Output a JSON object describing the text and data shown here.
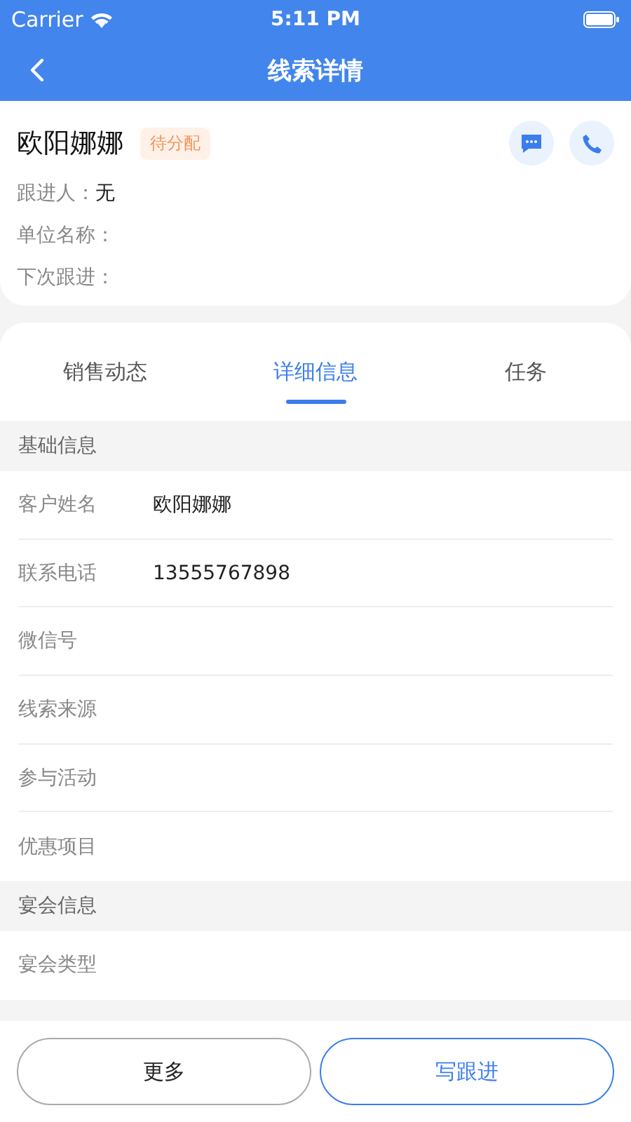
{
  "status_bar": {
    "carrier": "Carrier",
    "time": "5:11 PM"
  },
  "nav": {
    "title": "线索详情"
  },
  "lead": {
    "name": "欧阳娜娜",
    "badge": "待分配",
    "fields": [
      {
        "label": "跟进人：",
        "value": "无"
      },
      {
        "label": "单位名称："
      },
      {
        "label": "下次跟进："
      }
    ]
  },
  "tabs": [
    {
      "label": "销售动态",
      "selected": false
    },
    {
      "label": "详细信息",
      "selected": true
    },
    {
      "label": "任务",
      "selected": false
    }
  ],
  "sections": [
    {
      "title": "基础信息",
      "rows": [
        {
          "label": "客户姓名",
          "value": "欧阳娜娜"
        },
        {
          "label": "联系电话",
          "value": "13555767898"
        },
        {
          "label": "微信号"
        },
        {
          "label": "线索来源"
        },
        {
          "label": "参与活动"
        },
        {
          "label": "优惠项目"
        }
      ]
    },
    {
      "title": "宴会信息",
      "rows": [
        {
          "label": "宴会类型"
        }
      ]
    }
  ],
  "buttons": [
    {
      "label": "更多",
      "kind": "secondary"
    },
    {
      "label": "写跟进",
      "kind": "primary"
    }
  ]
}
